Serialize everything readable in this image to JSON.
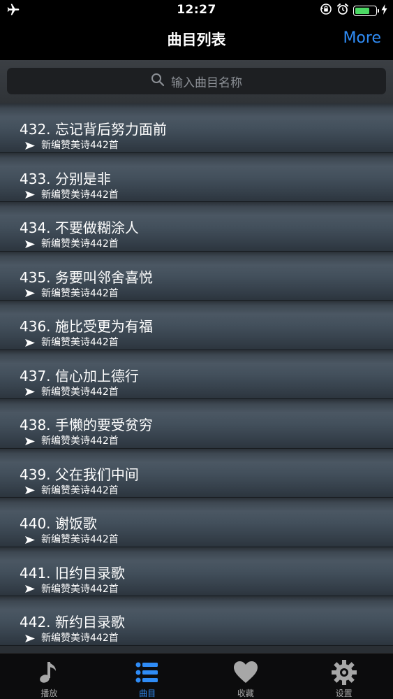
{
  "status_bar": {
    "time": "12:27",
    "battery_level": 0.75
  },
  "nav": {
    "title": "曲目列表",
    "more_label": "More"
  },
  "search": {
    "placeholder": "输入曲目名称",
    "icon": "search-icon"
  },
  "songs": [
    {
      "title": "432. 忘记背后努力面前",
      "subtitle": "新编赞美诗442首"
    },
    {
      "title": "433. 分别是非",
      "subtitle": "新编赞美诗442首"
    },
    {
      "title": "434. 不要做糊涂人",
      "subtitle": "新编赞美诗442首"
    },
    {
      "title": "435. 务要叫邻舍喜悦",
      "subtitle": "新编赞美诗442首"
    },
    {
      "title": "436. 施比受更为有福",
      "subtitle": "新编赞美诗442首"
    },
    {
      "title": "437. 信心加上德行",
      "subtitle": "新编赞美诗442首"
    },
    {
      "title": "438. 手懒的要受贫穷",
      "subtitle": "新编赞美诗442首"
    },
    {
      "title": "439. 父在我们中间",
      "subtitle": "新编赞美诗442首"
    },
    {
      "title": "440. 谢饭歌",
      "subtitle": "新编赞美诗442首"
    },
    {
      "title": "441. 旧约目录歌",
      "subtitle": "新编赞美诗442首"
    },
    {
      "title": "442. 新约目录歌",
      "subtitle": "新编赞美诗442首"
    }
  ],
  "tabs": [
    {
      "label": "播放",
      "icon": "music-note-icon",
      "active": false
    },
    {
      "label": "曲目",
      "icon": "list-icon",
      "active": true
    },
    {
      "label": "收藏",
      "icon": "heart-icon",
      "active": false
    },
    {
      "label": "设置",
      "icon": "gear-icon",
      "active": false
    }
  ],
  "colors": {
    "accent": "#2f8cf6",
    "battery": "#4cd964",
    "inactive_tab": "#a7a7a7"
  }
}
